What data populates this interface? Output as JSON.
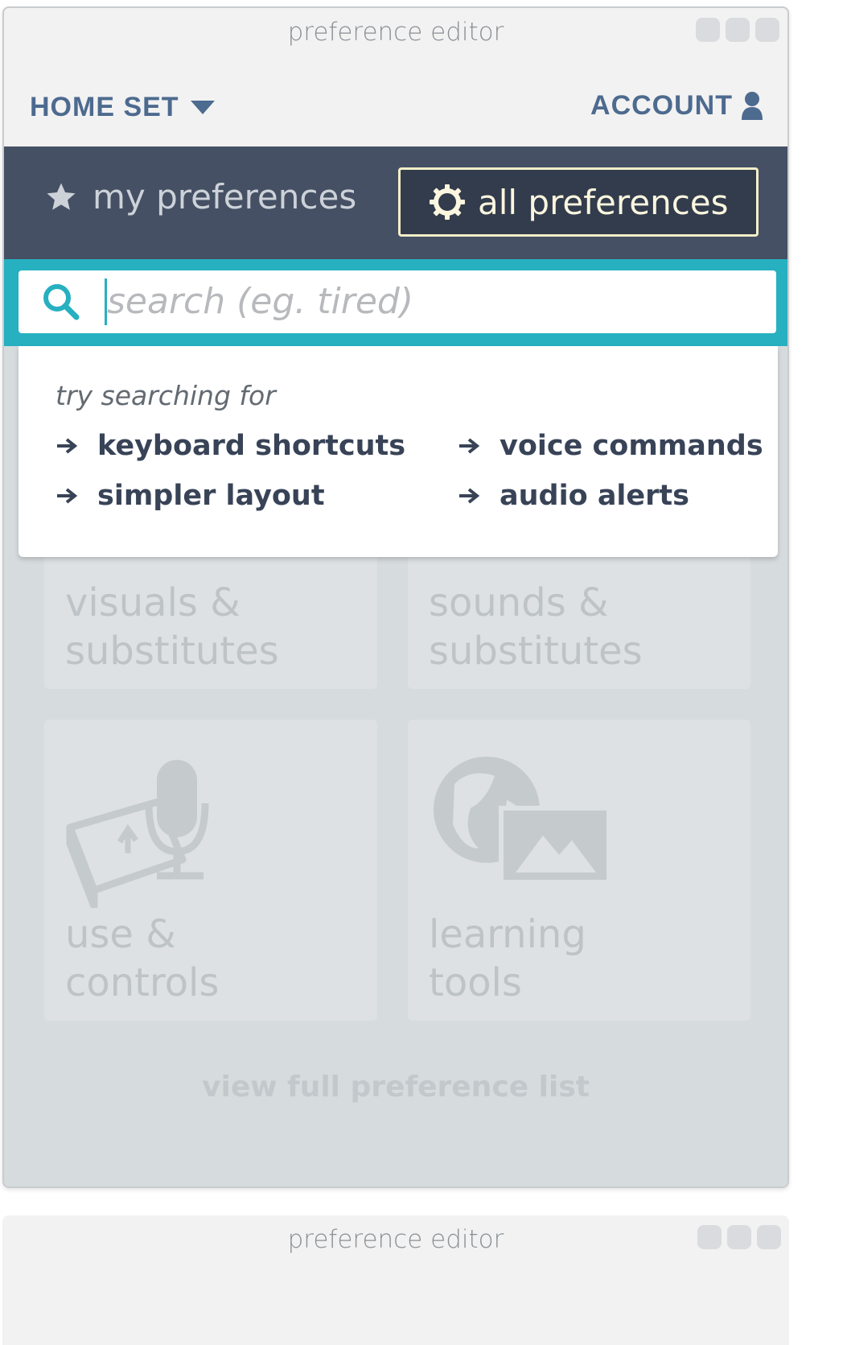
{
  "window": {
    "title": "preference editor"
  },
  "nav": {
    "home_set": "HOME SET",
    "account": "ACCOUNT"
  },
  "tabs": [
    {
      "label": "my preferences",
      "icon": "star-icon",
      "active": false
    },
    {
      "label": "all preferences",
      "icon": "gear-icon",
      "active": true
    }
  ],
  "search": {
    "placeholder": "search (eg. tired)",
    "value": ""
  },
  "suggestions": {
    "heading": "try searching for",
    "items": [
      "keyboard shortcuts",
      "voice commands",
      "simpler layout",
      "audio alerts"
    ]
  },
  "cards": [
    {
      "line1": "visuals &",
      "line2": "substitutes"
    },
    {
      "line1": "sounds &",
      "line2": "substitutes"
    },
    {
      "line1": "use &",
      "line2": "controls",
      "icon": "keyboard-microphone-icon"
    },
    {
      "line1": "learning",
      "line2": "tools",
      "icon": "globe-image-icon"
    }
  ],
  "view_full": "view full preference list",
  "second_window": {
    "title": "preference editor"
  },
  "colors": {
    "accent": "#26b0c0",
    "nav_text": "#4d6a8f",
    "tabbar": "#455064",
    "active_tab_border": "#f4efc8"
  }
}
